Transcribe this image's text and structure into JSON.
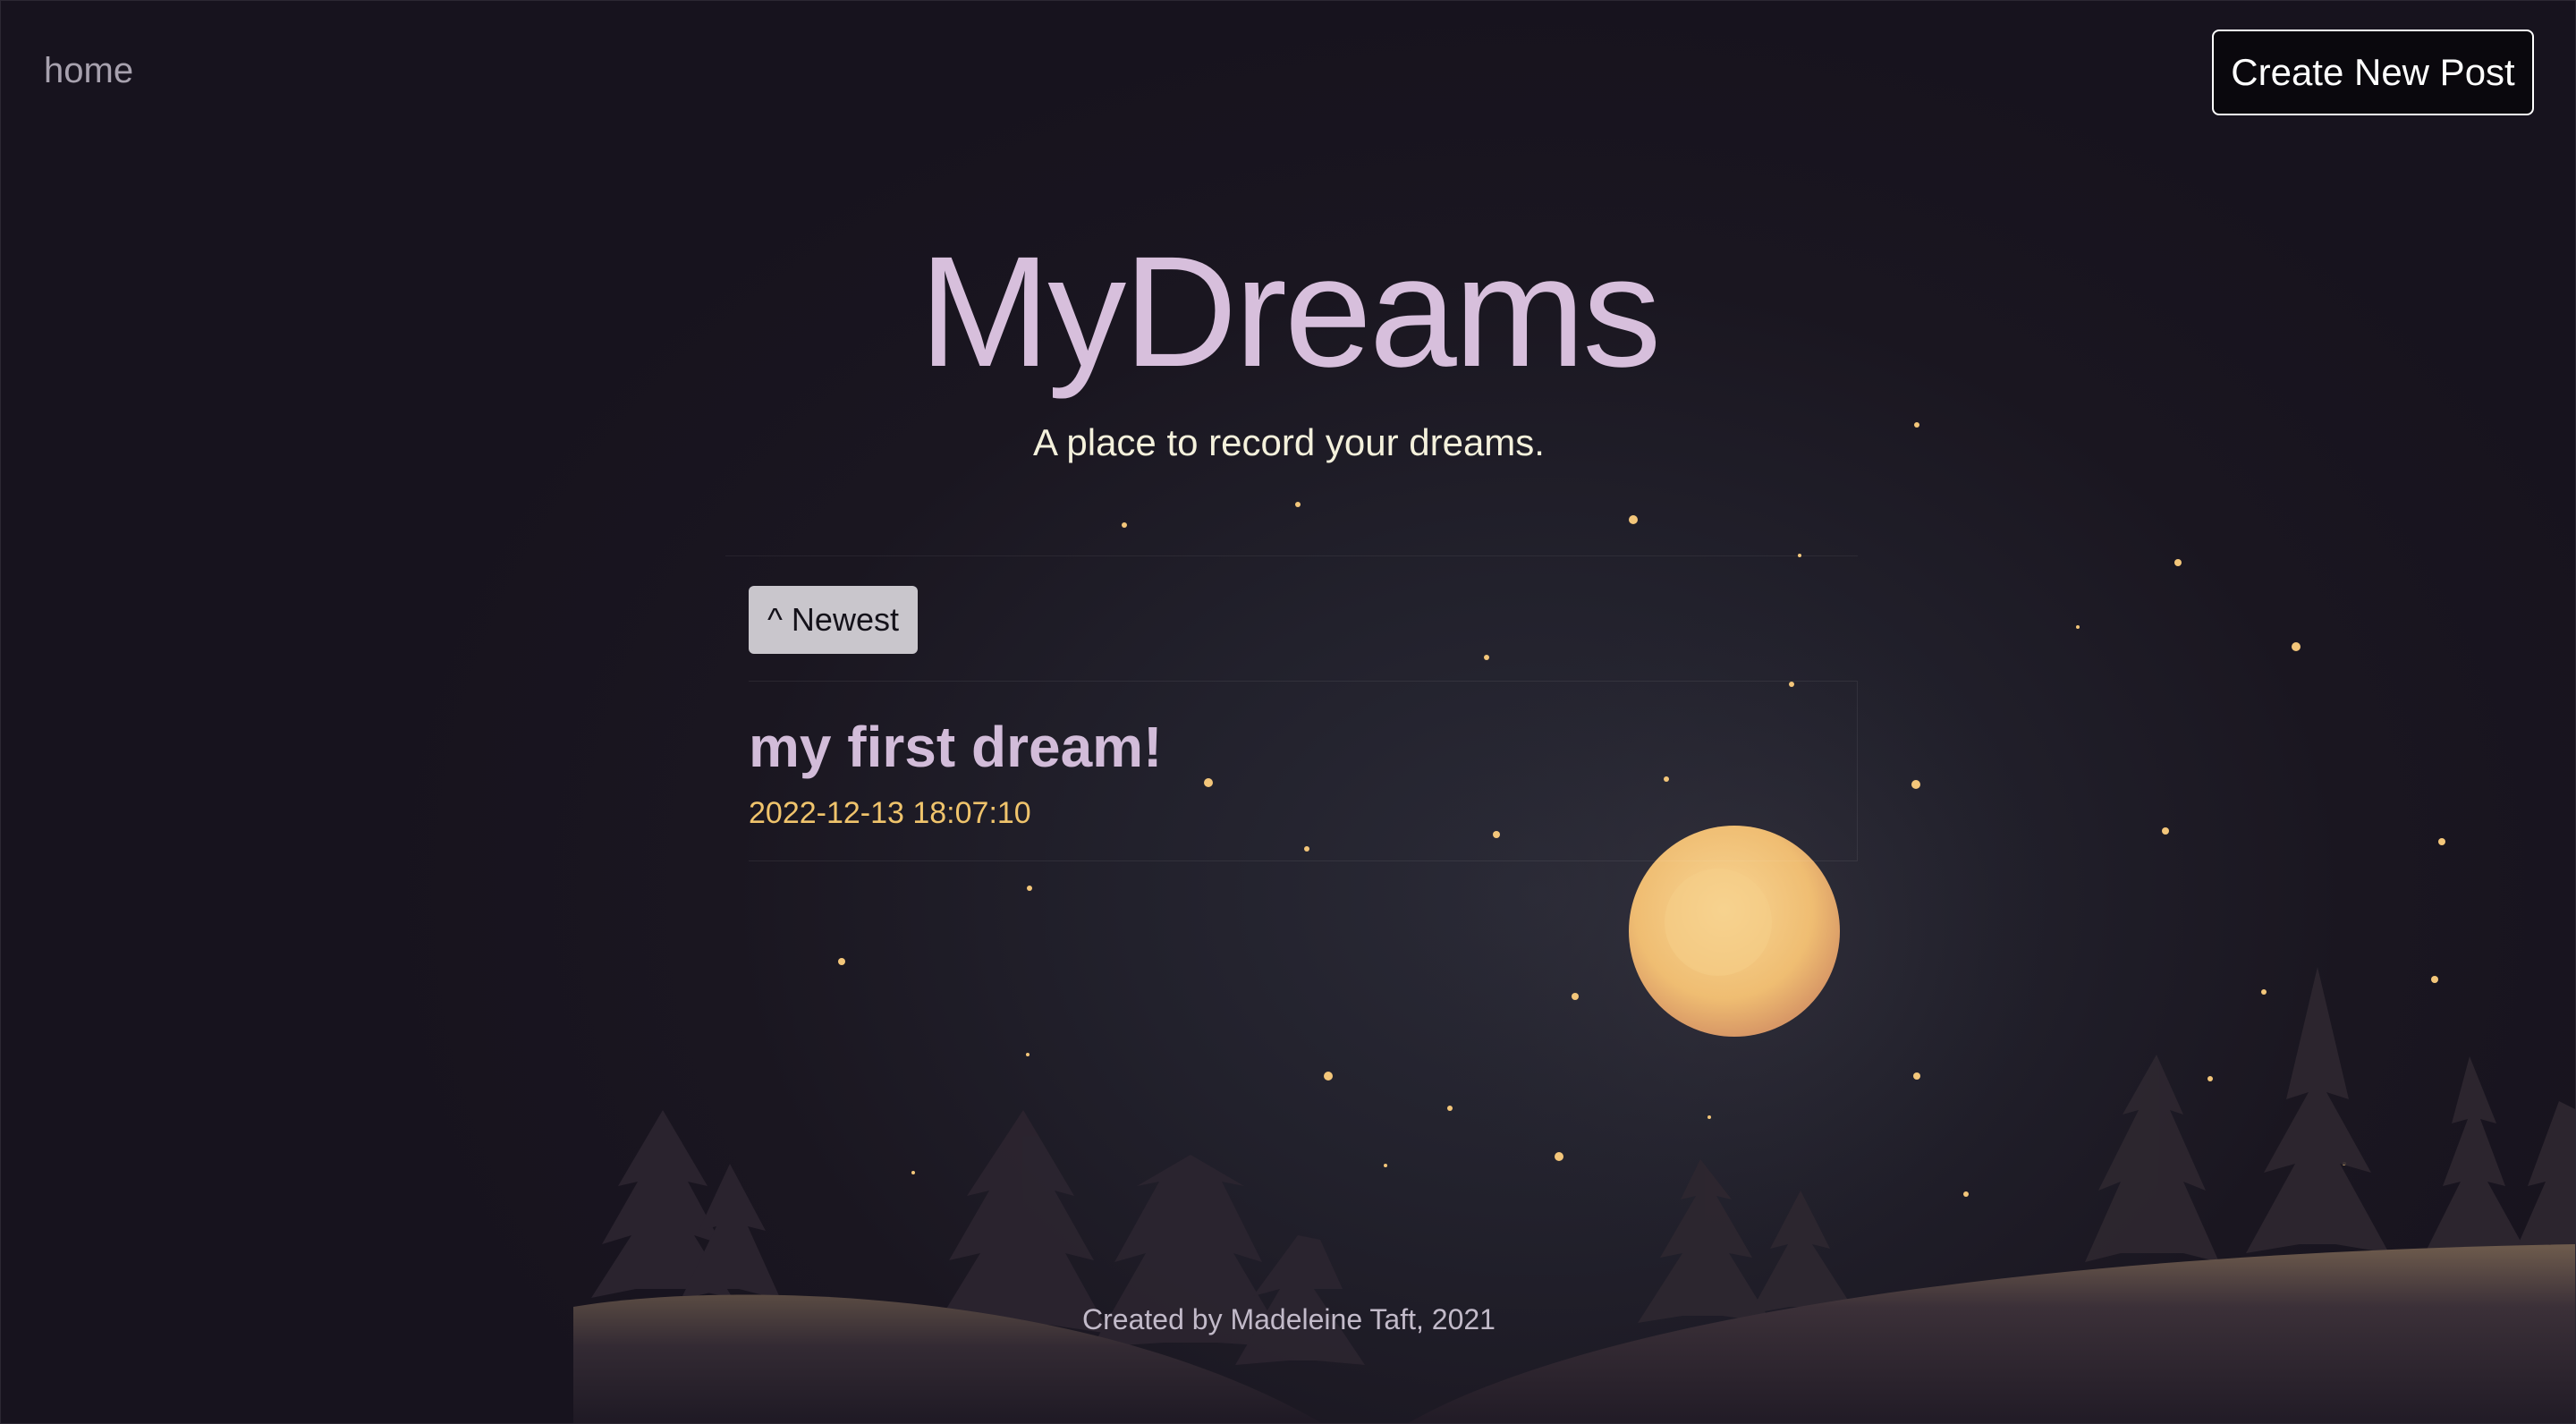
{
  "nav": {
    "home_label": "home",
    "create_label": "Create New Post"
  },
  "hero": {
    "title": "MyDreams",
    "subtitle": "A place to record your dreams."
  },
  "sort": {
    "label": "^ Newest"
  },
  "posts": [
    {
      "title": "my first dream!",
      "timestamp": "2022-12-13 18:07:10"
    }
  ],
  "footer": {
    "text": "Created by Madeleine Taft, 2021"
  },
  "colors": {
    "background": "#17131e",
    "title": "#d7bfdc",
    "subtitle": "#f4f1dc",
    "post_title": "#d2bcd9",
    "date": "#f0c46c",
    "moon": "#f3c47b",
    "sort_button_bg": "#c9c6cc"
  }
}
